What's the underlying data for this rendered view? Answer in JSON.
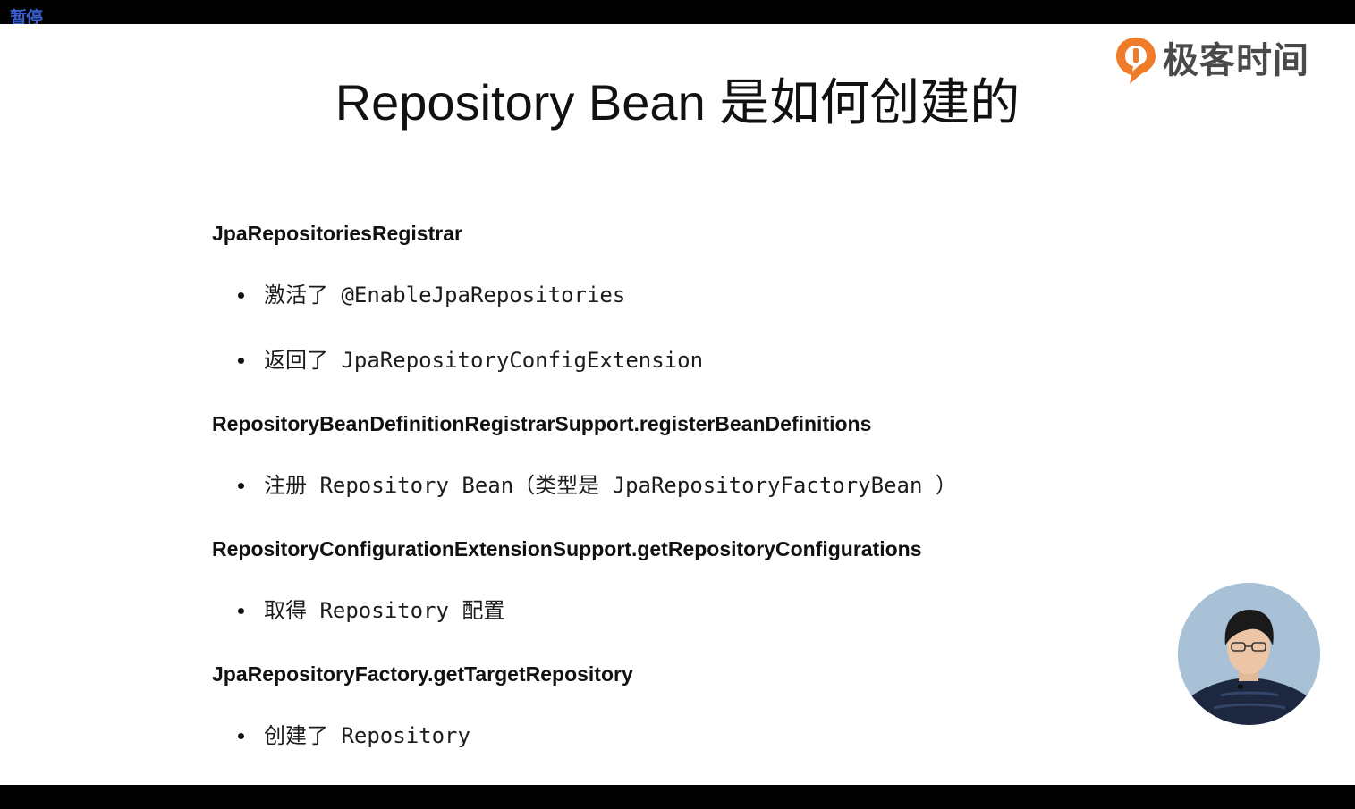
{
  "player": {
    "pause_label": "暂停"
  },
  "brand": {
    "logo_text": "极客时间",
    "accent_color": "#f07c2a"
  },
  "slide": {
    "title": "Repository Bean 是如何创建的",
    "sections": [
      {
        "heading": "JpaRepositoriesRegistrar",
        "bullets": [
          "激活了 @EnableJpaRepositories",
          "返回了 JpaRepositoryConfigExtension"
        ]
      },
      {
        "heading": "RepositoryBeanDefinitionRegistrarSupport.registerBeanDefinitions",
        "bullets": [
          "注册 Repository Bean（类型是 JpaRepositoryFactoryBean ）"
        ]
      },
      {
        "heading": "RepositoryConfigurationExtensionSupport.getRepositoryConfigurations",
        "bullets": [
          "取得 Repository 配置"
        ]
      },
      {
        "heading": "JpaRepositoryFactory.getTargetRepository",
        "bullets": [
          "创建了 Repository"
        ]
      }
    ]
  }
}
